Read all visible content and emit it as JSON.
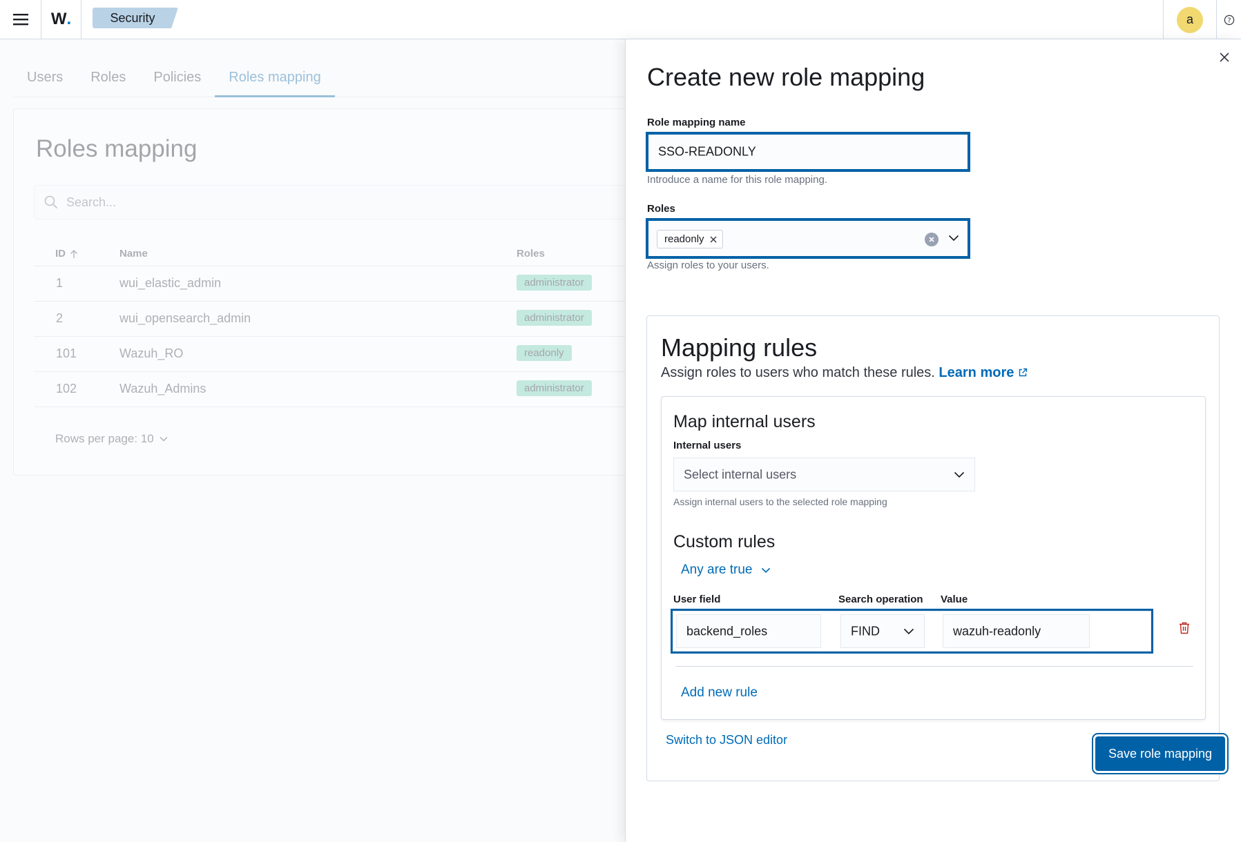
{
  "header": {
    "logo": "W",
    "breadcrumb": "Security",
    "avatar_letter": "a"
  },
  "background": {
    "tabs": [
      "Users",
      "Roles",
      "Policies",
      "Roles mapping"
    ],
    "active_tab": "Roles mapping",
    "panel_title": "Roles mapping",
    "search_placeholder": "Search...",
    "columns": {
      "id": "ID",
      "name": "Name",
      "roles": "Roles"
    },
    "rows": [
      {
        "id": "1",
        "name": "wui_elastic_admin",
        "role": "administrator"
      },
      {
        "id": "2",
        "name": "wui_opensearch_admin",
        "role": "administrator"
      },
      {
        "id": "101",
        "name": "Wazuh_RO",
        "role": "readonly"
      },
      {
        "id": "102",
        "name": "Wazuh_Admins",
        "role": "administrator"
      }
    ],
    "rows_per_page": "Rows per page: 10"
  },
  "flyout": {
    "title": "Create new role mapping",
    "name_label": "Role mapping name",
    "name_value": "SSO-READONLY",
    "name_help": "Introduce a name for this role mapping.",
    "roles_label": "Roles",
    "roles_selected": [
      "readonly"
    ],
    "roles_help": "Assign roles to your users.",
    "mapping": {
      "title": "Mapping rules",
      "description": "Assign roles to users who match these rules.",
      "learn_more": "Learn more",
      "internal": {
        "title": "Map internal users",
        "label": "Internal users",
        "placeholder": "Select internal users",
        "help": "Assign internal users to the selected role mapping"
      },
      "custom": {
        "title": "Custom rules",
        "operator": "Any are true",
        "user_field_label": "User field",
        "search_op_label": "Search operation",
        "value_label": "Value",
        "user_field": "backend_roles",
        "search_op": "FIND",
        "value": "wazuh-readonly",
        "add_rule": "Add new rule"
      },
      "switch_json": "Switch to JSON editor"
    },
    "save_button": "Save role mapping"
  },
  "colors": {
    "primary": "#0061a6",
    "link": "#006bb8",
    "avatar": "#f1d86f",
    "danger": "#bd271e"
  }
}
